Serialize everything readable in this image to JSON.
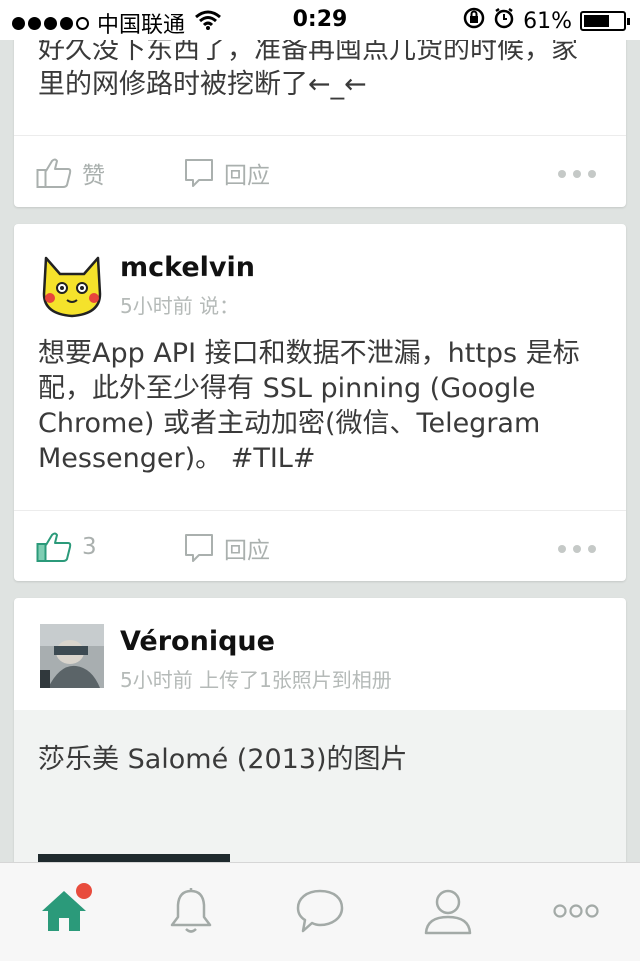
{
  "status_bar": {
    "carrier": "中国联通",
    "time": "0:29",
    "battery_percent": "61%"
  },
  "feed": {
    "post1": {
      "text": "好久没下东西了，准备再囤点儿货的时候，家里的网修路时被挖断了←_←",
      "like_label": "赞",
      "reply_label": "回应"
    },
    "post2": {
      "username": "mckelvin",
      "meta": "5小时前 说：",
      "text": "想要App API 接口和数据不泄漏，https 是标配，此外至少得有 SSL pinning (Google Chrome) 或者主动加密(微信、Telegram Messenger)。 #TIL#",
      "like_count": "3",
      "reply_label": "回应"
    },
    "post3": {
      "username": "Véronique",
      "meta": "5小时前 上传了1张照片到相册",
      "caption": "莎乐美 Salomé (2013)的图片"
    }
  },
  "tab_bar": {
    "tabs": [
      "home-icon",
      "bell-icon",
      "chat-bubble-icon",
      "profile-icon",
      "more-icon"
    ],
    "active": "home",
    "home_has_notification": true
  },
  "colors": {
    "accent": "#2b9a7a",
    "notification": "#e84c3d",
    "muted": "#aab0ae",
    "background": "#dfe3e1"
  }
}
